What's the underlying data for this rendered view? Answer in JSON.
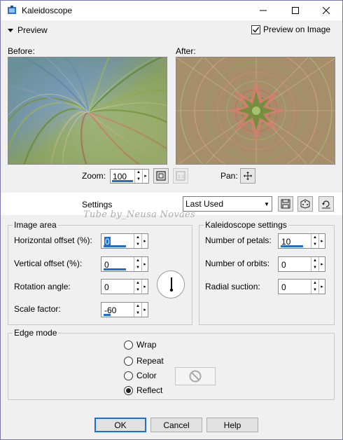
{
  "window": {
    "title": "Kaleidoscope",
    "minimize_icon": "minimize-icon",
    "maximize_icon": "maximize-icon",
    "close_icon": "close-icon"
  },
  "preview": {
    "toggle_label": "Preview",
    "preview_on_image_label": "Preview on Image",
    "preview_on_image_checked": true,
    "before_label": "Before:",
    "after_label": "After:",
    "zoom_label": "Zoom:",
    "zoom_value": "100",
    "pan_label": "Pan:"
  },
  "settings": {
    "label": "Settings",
    "preset_value": "Last Used",
    "watermark": "Tube by_Neusa Novaes"
  },
  "image_area": {
    "caption": "Image area",
    "horizontal_offset_label": "Horizontal offset (%):",
    "horizontal_offset_value": "0",
    "vertical_offset_label": "Vertical offset (%):",
    "vertical_offset_value": "0",
    "rotation_angle_label": "Rotation angle:",
    "rotation_angle_value": "0",
    "scale_factor_label": "Scale factor:",
    "scale_factor_value": "-60"
  },
  "kaleidoscope_settings": {
    "caption": "Kaleidoscope settings",
    "petals_label": "Number of petals:",
    "petals_value": "10",
    "orbits_label": "Number of orbits:",
    "orbits_value": "0",
    "radial_suction_label": "Radial suction:",
    "radial_suction_value": "0"
  },
  "edge_mode": {
    "caption": "Edge mode",
    "options": [
      "Wrap",
      "Repeat",
      "Color",
      "Reflect"
    ],
    "selected": "Reflect"
  },
  "buttons": {
    "ok": "OK",
    "cancel": "Cancel",
    "help": "Help"
  },
  "colors": {
    "accent": "#1e6fd0",
    "window_bg": "#f0f0f0"
  }
}
